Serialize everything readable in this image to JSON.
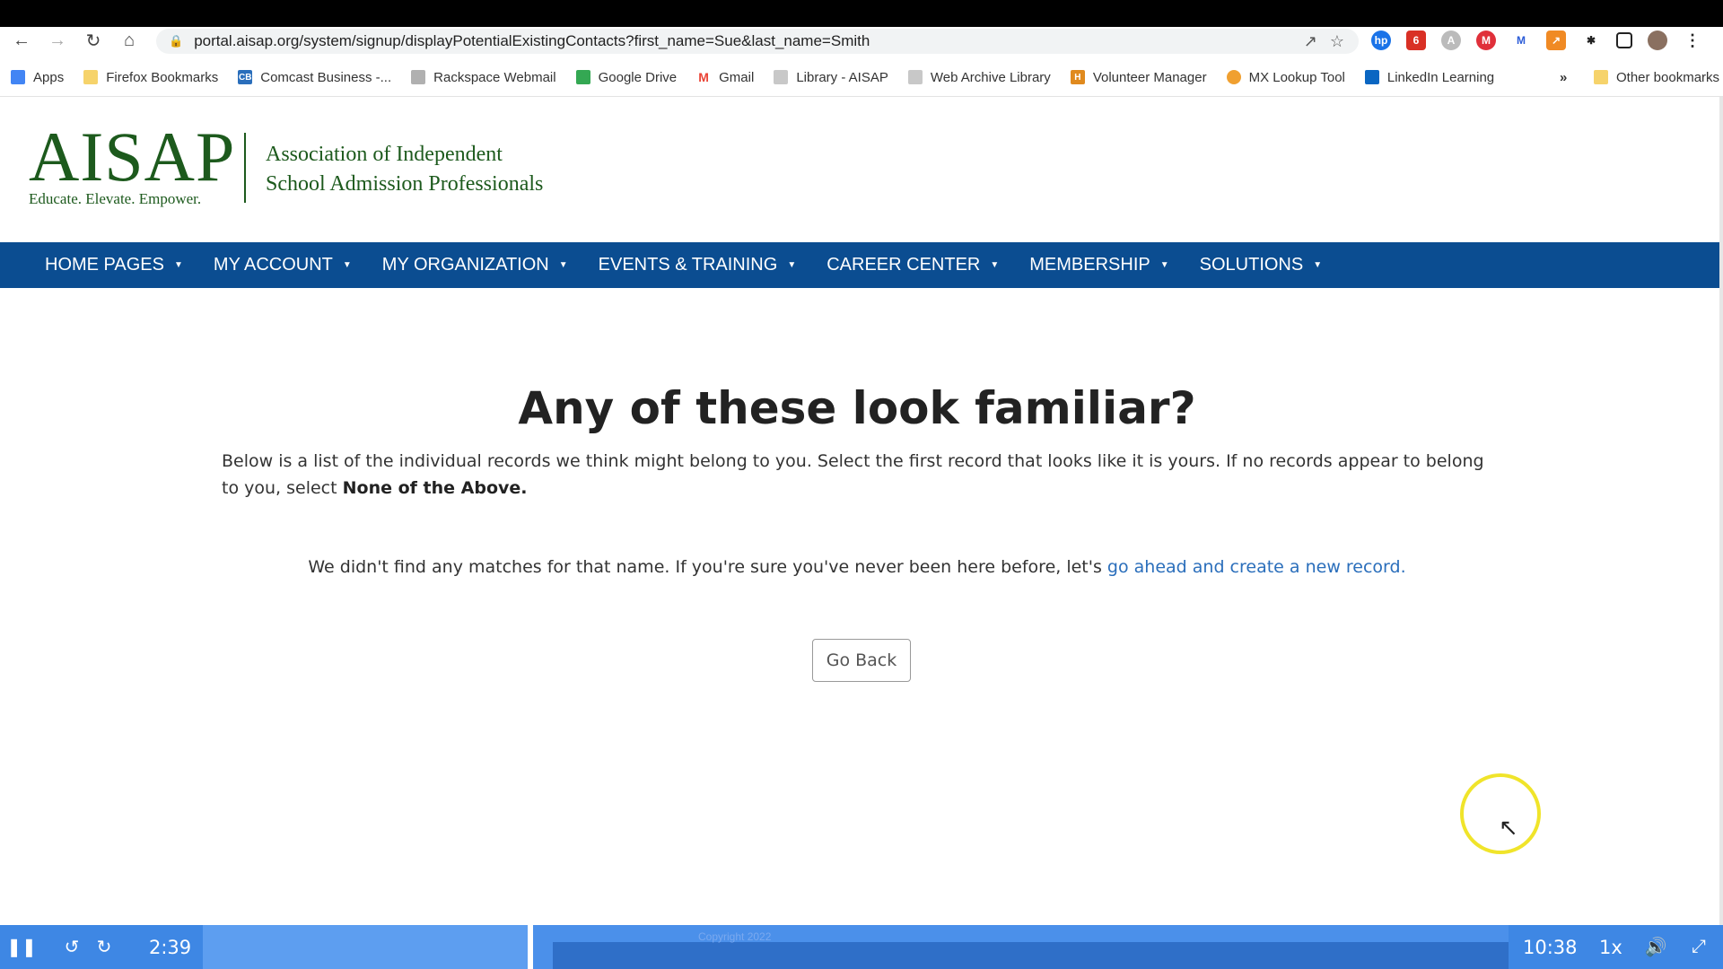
{
  "browser": {
    "url": "portal.aisap.org/system/signup/displayPotentialExistingContacts?first_name=Sue&last_name=Smith",
    "bookmarks": [
      {
        "label": "Apps",
        "color": "#4285f4"
      },
      {
        "label": "Firefox Bookmarks",
        "color": "#f6d36b"
      },
      {
        "label": "Comcast Business -...",
        "color": "#2a6ebb"
      },
      {
        "label": "Rackspace Webmail",
        "color": "#b0b0b0"
      },
      {
        "label": "Google Drive",
        "color": "#34a853"
      },
      {
        "label": "Gmail",
        "color": "#ea4335"
      },
      {
        "label": "Library - AISAP",
        "color": "#c8c8c8"
      },
      {
        "label": "Web Archive Library",
        "color": "#c8c8c8"
      },
      {
        "label": "Volunteer Manager",
        "color": "#e08a1e"
      },
      {
        "label": "MX Lookup Tool",
        "color": "#f0a030"
      },
      {
        "label": "LinkedIn Learning",
        "color": "#0a66c2"
      }
    ],
    "bookmarks_more": "»",
    "other_bookmarks": "Other bookmarks"
  },
  "header": {
    "logo_word": "AISAP",
    "logo_tagline": "Educate. Elevate. Empower.",
    "org_line1": "Association of Independent",
    "org_line2": "School Admission Professionals",
    "brand_color": "#1d5a1d"
  },
  "nav": {
    "items": [
      {
        "label": "HOME PAGES"
      },
      {
        "label": "MY ACCOUNT"
      },
      {
        "label": "MY ORGANIZATION"
      },
      {
        "label": "EVENTS & TRAINING"
      },
      {
        "label": "CAREER CENTER"
      },
      {
        "label": "MEMBERSHIP"
      },
      {
        "label": "SOLUTIONS"
      }
    ],
    "bar_color": "#0b4d91"
  },
  "main": {
    "heading": "Any of these look familiar?",
    "intro_text": "Below is a list of the individual records we think might belong to you. Select the first record that looks like it is yours. If no records appear to belong to you, select ",
    "intro_bold": "None of the Above.",
    "nomatch_text": "We didn't find any matches for that name. If you're sure you've never been here before, let's ",
    "nomatch_link": "go ahead and create a new record.",
    "go_back_label": "Go Back"
  },
  "player": {
    "current_time": "2:39",
    "total_time": "10:38",
    "speed": "1x",
    "progress_fraction": 0.249,
    "footer_text": "Copyright 2022"
  }
}
